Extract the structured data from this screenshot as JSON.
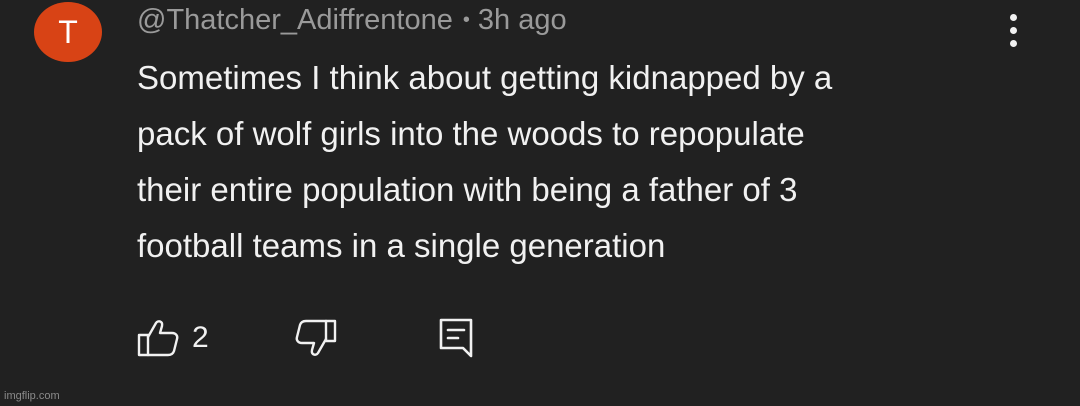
{
  "comment": {
    "avatar_letter": "T",
    "avatar_color": "#d84315",
    "author": "@Thatcher_Adiffrentone",
    "separator": "•",
    "timestamp": "3h ago",
    "text_lines": [
      "Sometimes I think about getting kidnapped by a",
      "pack of wolf girls into the woods to repopulate",
      "their entire population with being a father of 3",
      "football teams in a single generation"
    ],
    "like_count": "2",
    "icons": {
      "like": "thumbs-up-icon",
      "dislike": "thumbs-down-icon",
      "reply": "reply-comment-icon",
      "menu": "more-vertical-icon"
    }
  },
  "watermark": "imgflip.com",
  "colors": {
    "background": "#212121",
    "text": "#f1f1f1",
    "meta": "#9a9a9a"
  }
}
